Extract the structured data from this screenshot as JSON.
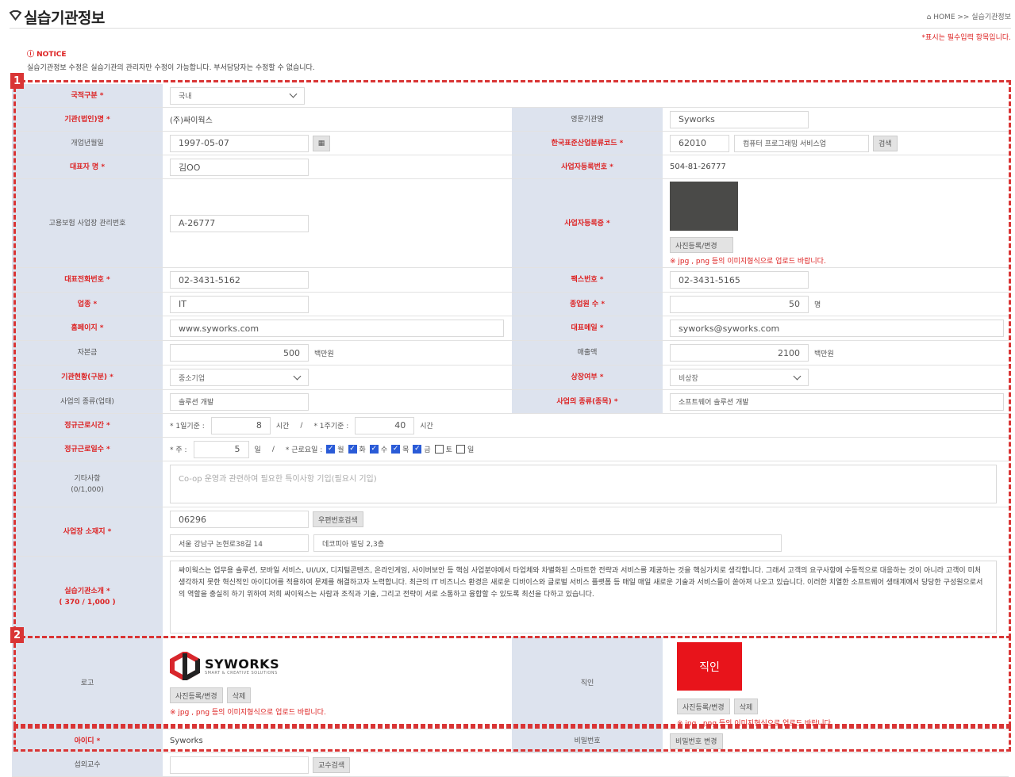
{
  "header": {
    "title": "실습기관정보",
    "breadcrumb": "HOME >> 실습기관정보",
    "required_note": "*표시는 필수입력 항목입니다."
  },
  "notice": {
    "title": "NOTICE",
    "text": "실습기관정보 수정은 실습기관의 관리자만 수정이 가능합니다. 부서담당자는 수정할 수 없습니다."
  },
  "markers": [
    "1",
    "2"
  ],
  "labels": {
    "nationality": "국적구분 *",
    "org_name": "기관(법인)명 *",
    "eng_name": "영문기관명",
    "founded": "개업년월일",
    "industry_code": "한국표준산업분류코드 *",
    "ceo": "대표자 명 *",
    "biz_reg_no": "사업자등록번호 *",
    "insurance_no": "고용보험 사업장 관리번호",
    "biz_cert": "사업자등록증 *",
    "phone": "대표전화번호 *",
    "fax": "팩스번호 *",
    "business_type": "업종 *",
    "employees": "종업원 수 *",
    "homepage": "홈페이지 *",
    "email": "대표메일 *",
    "capital": "자본금",
    "sales": "매출액",
    "org_status": "기관현황(구분) *",
    "listed": "상장여부 *",
    "biz_category": "사업의 종류(업태)",
    "biz_item": "사업의 종류(종목) *",
    "work_hours": "정규근로시간 *",
    "work_days": "정규근로일수 *",
    "etc": "기타사항\n(0/1,000)",
    "address": "사업장 소재지 *",
    "intro": "실습기관소개 *\n( 370 / 1,000 )",
    "logo": "로고",
    "seal": "직인",
    "user_id": "아이디 *",
    "password": "비밀번호",
    "professor": "섭외교수"
  },
  "values": {
    "nationality": "국내",
    "org_name": "(주)싸이웍스",
    "eng_name": "Syworks",
    "founded": "1997-05-07",
    "industry_code": "62010",
    "industry_name": "컴퓨터 프로그래밍 서비스업",
    "ceo": "김OO",
    "biz_reg_no": "504-81-26777",
    "insurance_no": "A-26777",
    "phone": "02-3431-5162",
    "fax": "02-3431-5165",
    "business_type": "IT",
    "employees": "50",
    "homepage": "www.syworks.com",
    "email": "syworks@syworks.com",
    "capital": "500",
    "sales": "2100",
    "org_status": "중소기업",
    "listed": "비상장",
    "biz_category": "솔루션 개발",
    "biz_item": "소프트웨어 솔루션 개발",
    "daily_hours": "8",
    "weekly_hours": "40",
    "week_days": "5",
    "etc_placeholder": "Co-op 운영과 관련하여 필요한 특이사항 기입(필요시 기입)",
    "zip": "06296",
    "addr1": "서울 강남구 논현로38길 14",
    "addr2": "데코피아 빌딩 2,3층",
    "intro": "싸이웍스는 업무용 솔루션, 모바일 서비스, UI/UX, 디지털콘텐츠, 온라인게임, 사이버보안 등 핵심 사업분야에서 타업체와 차별화된 스마트한 전략과 서비스를 제공하는 것을 핵심가치로 생각합니다. 그래서 고객의 요구사항에 수동적으로 대응하는 것이 아니라 고객이 미처 생각하지 못한 혁신적인 아이디어를 적용하여 문제를 해결하고자 노력합니다. 최근의 IT 비즈니스 환경은 새로운 디바이스와 글로벌 서비스 플랫폼 등 매일 매일 새로운 기술과 서비스들이 쏟아져 나오고 있습니다. 이러한 치열한 소프트웨어 생태계에서 당당한 구성원으로서의 역할을 충실히 하기 위하여 저희 싸이웍스는 사람과 조직과 기술, 그리고 전략이 서로 소통하고 융합할 수 있도록 최선을 다하고 있습니다.",
    "logo_text": "SYWORKS",
    "logo_sub": "SMART & CREATIVE SOLUTIONS",
    "seal_text": "직인",
    "user_id": "Syworks",
    "professor": ""
  },
  "units": {
    "person": "명",
    "million_won": "백만원",
    "hour": "시간"
  },
  "inline": {
    "daily_label": "* 1일기준 :",
    "weekly_label": "* 1주기준 :",
    "slash": "/",
    "week_label": "* 주 :",
    "day_unit": "일",
    "workday_label": "* 근로요일 :"
  },
  "weekdays": [
    {
      "label": "월",
      "checked": true
    },
    {
      "label": "화",
      "checked": true
    },
    {
      "label": "수",
      "checked": true
    },
    {
      "label": "목",
      "checked": true
    },
    {
      "label": "금",
      "checked": true
    },
    {
      "label": "토",
      "checked": false
    },
    {
      "label": "일",
      "checked": false
    }
  ],
  "buttons": {
    "search": "검색",
    "photo_upload": "사진등록/변경",
    "delete": "삭제",
    "zip_search": "우편번호검색",
    "password_change": "비밀번호 변경",
    "professor_search": "교수검색"
  },
  "warnings": {
    "image_format": "※ jpg , png 등의 이미지형식으로 업로드 바랍니다."
  },
  "colors": {
    "label_bg": "#dde3ee",
    "required_text": "#dd2222",
    "annotation": "#d93535",
    "checkbox": "#2a5bd7",
    "seal": "#e8141b"
  }
}
